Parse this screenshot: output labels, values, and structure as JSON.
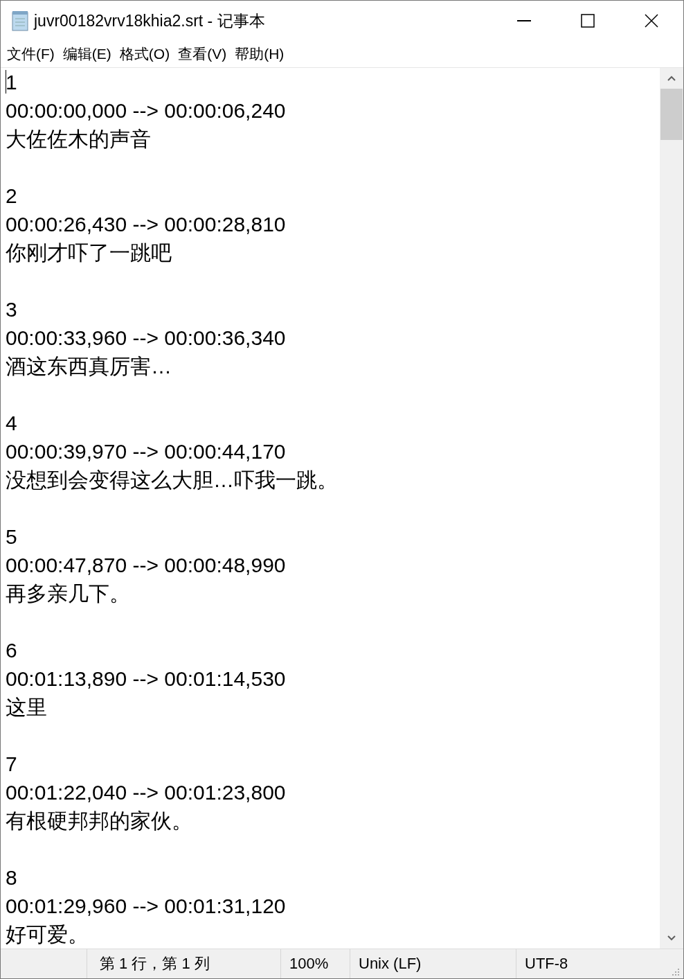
{
  "window": {
    "title": "juvr00182vrv18khia2.srt - 记事本"
  },
  "menu": [
    "文件(F)",
    "编辑(E)",
    "格式(O)",
    "查看(V)",
    "帮助(H)"
  ],
  "subtitles": [
    {
      "number": "1",
      "timing": "00:00:00,000 --> 00:00:06,240",
      "text": "大佐佐木的声音"
    },
    {
      "number": "2",
      "timing": "00:00:26,430 --> 00:00:28,810",
      "text": "你刚才吓了一跳吧"
    },
    {
      "number": "3",
      "timing": "00:00:33,960 --> 00:00:36,340",
      "text": "酒这东西真厉害…"
    },
    {
      "number": "4",
      "timing": "00:00:39,970 --> 00:00:44,170",
      "text": "没想到会变得这么大胆…吓我一跳。"
    },
    {
      "number": "5",
      "timing": "00:00:47,870 --> 00:00:48,990",
      "text": "再多亲几下。"
    },
    {
      "number": "6",
      "timing": "00:01:13,890 --> 00:01:14,530",
      "text": "这里"
    },
    {
      "number": "7",
      "timing": "00:01:22,040 --> 00:01:23,800",
      "text": "有根硬邦邦的家伙。"
    },
    {
      "number": "8",
      "timing": "00:01:29,960 --> 00:01:31,120",
      "text": "好可爱。"
    }
  ],
  "status_bar": {
    "position": "第 1 行，第 1 列",
    "zoom": "100%",
    "line_ending": "Unix (LF)",
    "encoding": "UTF-8"
  }
}
